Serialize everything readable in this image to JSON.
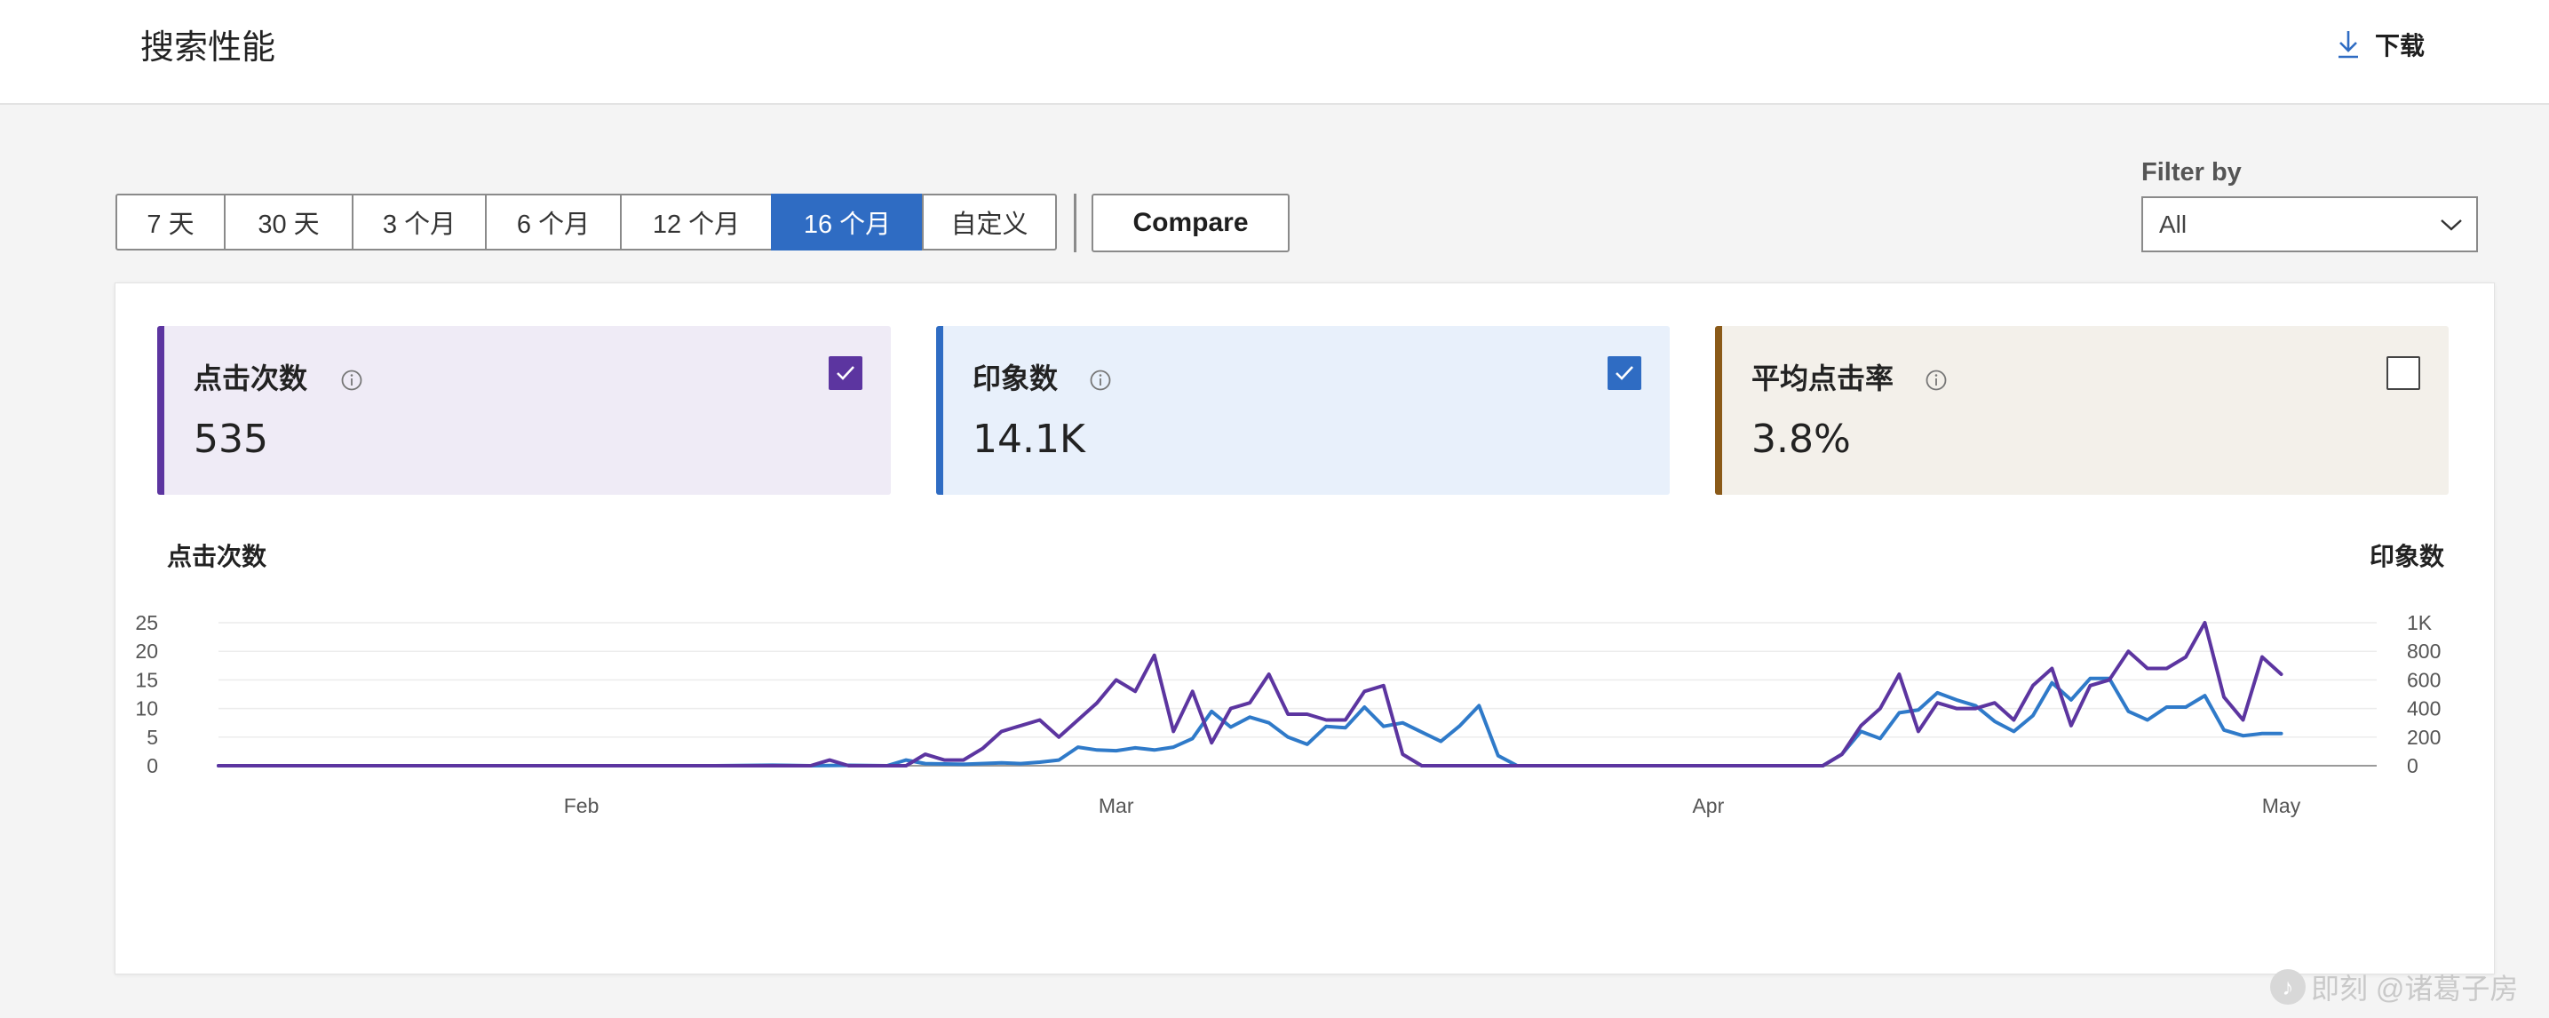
{
  "header": {
    "title": "搜索性能",
    "download_label": "下载"
  },
  "toolbar": {
    "ranges": [
      "7 天",
      "30 天",
      "3 个月",
      "6 个月",
      "12 个月",
      "16 个月",
      "自定义"
    ],
    "active_range": "16 个月",
    "compare_label": "Compare",
    "filter_label": "Filter by",
    "filter_value": "All"
  },
  "metrics": [
    {
      "title": "点击次数",
      "value": "535",
      "checked": true,
      "color": "#5c35a0",
      "bg": "#efebf6"
    },
    {
      "title": "印象数",
      "value": "14.1K",
      "checked": true,
      "color": "#2f6cc3",
      "bg": "#e8f0fb"
    },
    {
      "title": "平均点击率",
      "value": "3.8%",
      "checked": false,
      "color": "#8a5a19",
      "bg": "#f3f0ea"
    }
  ],
  "chart_data": {
    "type": "line",
    "left_axis_title": "点击次数",
    "right_axis_title": "印象数",
    "left_ticks": [
      "0",
      "5",
      "10",
      "15",
      "20",
      "25"
    ],
    "right_ticks": [
      "0",
      "200",
      "400",
      "600",
      "800",
      "1K"
    ],
    "ylim_left": [
      0,
      25
    ],
    "ylim_right": [
      0,
      1000
    ],
    "x_range": [
      "2025-01-13",
      "2025-05-06"
    ],
    "x_ticks": [
      {
        "label": "Feb",
        "date": "2025-02-01"
      },
      {
        "label": "Mar",
        "date": "2025-03-01"
      },
      {
        "label": "Apr",
        "date": "2025-04-01"
      },
      {
        "label": "May",
        "date": "2025-05-01"
      }
    ],
    "series": [
      {
        "name": "印象数",
        "axis": "right",
        "color": "#2f7ac9",
        "points": [
          [
            "2025-01-13",
            0
          ],
          [
            "2025-02-01",
            0
          ],
          [
            "2025-02-08",
            0
          ],
          [
            "2025-02-11",
            4
          ],
          [
            "2025-02-13",
            0
          ],
          [
            "2025-02-15",
            3
          ],
          [
            "2025-02-17",
            0
          ],
          [
            "2025-02-18",
            40
          ],
          [
            "2025-02-19",
            15
          ],
          [
            "2025-02-21",
            10
          ],
          [
            "2025-02-23",
            20
          ],
          [
            "2025-02-24",
            15
          ],
          [
            "2025-02-25",
            25
          ],
          [
            "2025-02-26",
            40
          ],
          [
            "2025-02-27",
            130
          ],
          [
            "2025-02-28",
            110
          ],
          [
            "2025-03-01",
            105
          ],
          [
            "2025-03-02",
            125
          ],
          [
            "2025-03-03",
            110
          ],
          [
            "2025-03-04",
            130
          ],
          [
            "2025-03-05",
            190
          ],
          [
            "2025-03-06",
            380
          ],
          [
            "2025-03-07",
            270
          ],
          [
            "2025-03-08",
            340
          ],
          [
            "2025-03-09",
            300
          ],
          [
            "2025-03-10",
            200
          ],
          [
            "2025-03-11",
            150
          ],
          [
            "2025-03-12",
            275
          ],
          [
            "2025-03-13",
            265
          ],
          [
            "2025-03-14",
            410
          ],
          [
            "2025-03-15",
            275
          ],
          [
            "2025-03-16",
            300
          ],
          [
            "2025-03-17",
            235
          ],
          [
            "2025-03-18",
            170
          ],
          [
            "2025-03-19",
            280
          ],
          [
            "2025-03-20",
            420
          ],
          [
            "2025-03-21",
            70
          ],
          [
            "2025-03-22",
            0
          ],
          [
            "2025-04-01",
            0
          ],
          [
            "2025-04-07",
            0
          ],
          [
            "2025-04-08",
            80
          ],
          [
            "2025-04-09",
            240
          ],
          [
            "2025-04-10",
            190
          ],
          [
            "2025-04-11",
            370
          ],
          [
            "2025-04-12",
            390
          ],
          [
            "2025-04-13",
            510
          ],
          [
            "2025-04-14",
            460
          ],
          [
            "2025-04-15",
            420
          ],
          [
            "2025-04-16",
            310
          ],
          [
            "2025-04-17",
            240
          ],
          [
            "2025-04-18",
            350
          ],
          [
            "2025-04-19",
            580
          ],
          [
            "2025-04-20",
            460
          ],
          [
            "2025-04-21",
            610
          ],
          [
            "2025-04-22",
            610
          ],
          [
            "2025-04-23",
            380
          ],
          [
            "2025-04-24",
            320
          ],
          [
            "2025-04-25",
            410
          ],
          [
            "2025-04-26",
            410
          ],
          [
            "2025-04-27",
            490
          ],
          [
            "2025-04-28",
            250
          ],
          [
            "2025-04-29",
            210
          ],
          [
            "2025-04-30",
            225
          ],
          [
            "2025-05-01",
            225
          ]
        ]
      },
      {
        "name": "点击次数",
        "axis": "left",
        "color": "#5c35a0",
        "points": [
          [
            "2025-01-13",
            0
          ],
          [
            "2025-02-01",
            0
          ],
          [
            "2025-02-13",
            0
          ],
          [
            "2025-02-14",
            1
          ],
          [
            "2025-02-15",
            0
          ],
          [
            "2025-02-18",
            0
          ],
          [
            "2025-02-19",
            2
          ],
          [
            "2025-02-20",
            1
          ],
          [
            "2025-02-21",
            1
          ],
          [
            "2025-02-22",
            3
          ],
          [
            "2025-02-23",
            6
          ],
          [
            "2025-02-24",
            7
          ],
          [
            "2025-02-25",
            8
          ],
          [
            "2025-02-26",
            5
          ],
          [
            "2025-02-27",
            8
          ],
          [
            "2025-02-28",
            11
          ],
          [
            "2025-03-01",
            15
          ],
          [
            "2025-03-02",
            13
          ],
          [
            "2025-03-03",
            19.3
          ],
          [
            "2025-03-04",
            6
          ],
          [
            "2025-03-05",
            13
          ],
          [
            "2025-03-06",
            4
          ],
          [
            "2025-03-07",
            10
          ],
          [
            "2025-03-08",
            11
          ],
          [
            "2025-03-09",
            16
          ],
          [
            "2025-03-10",
            9
          ],
          [
            "2025-03-11",
            9
          ],
          [
            "2025-03-12",
            8
          ],
          [
            "2025-03-13",
            8
          ],
          [
            "2025-03-14",
            13
          ],
          [
            "2025-03-15",
            14
          ],
          [
            "2025-03-16",
            2
          ],
          [
            "2025-03-17",
            0
          ],
          [
            "2025-04-01",
            0
          ],
          [
            "2025-04-07",
            0
          ],
          [
            "2025-04-08",
            2
          ],
          [
            "2025-04-09",
            7
          ],
          [
            "2025-04-10",
            10
          ],
          [
            "2025-04-11",
            16
          ],
          [
            "2025-04-12",
            6
          ],
          [
            "2025-04-13",
            11
          ],
          [
            "2025-04-14",
            10
          ],
          [
            "2025-04-15",
            10
          ],
          [
            "2025-04-16",
            11
          ],
          [
            "2025-04-17",
            8
          ],
          [
            "2025-04-18",
            14
          ],
          [
            "2025-04-19",
            17
          ],
          [
            "2025-04-20",
            7
          ],
          [
            "2025-04-21",
            14
          ],
          [
            "2025-04-22",
            15
          ],
          [
            "2025-04-23",
            20
          ],
          [
            "2025-04-24",
            17
          ],
          [
            "2025-04-25",
            17
          ],
          [
            "2025-04-26",
            19
          ],
          [
            "2025-04-27",
            25
          ],
          [
            "2025-04-28",
            12
          ],
          [
            "2025-04-29",
            8
          ],
          [
            "2025-04-30",
            19
          ],
          [
            "2025-05-01",
            16
          ]
        ]
      }
    ]
  },
  "watermark": {
    "text": "即刻 @诸葛子房"
  }
}
